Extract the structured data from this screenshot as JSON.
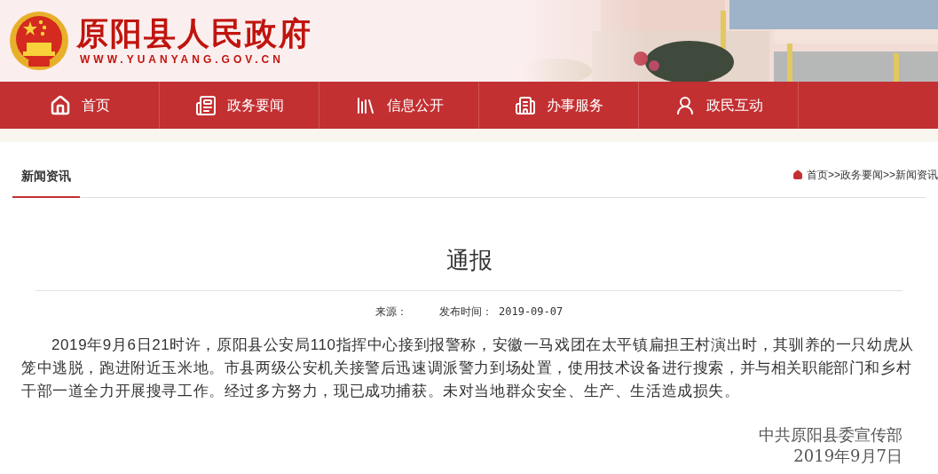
{
  "header": {
    "title": "原阳县人民政府",
    "url": "WWW.YUANYANG.GOV.CN"
  },
  "nav": [
    {
      "label": "首页",
      "kind": "home"
    },
    {
      "label": "政务要闻",
      "kind": "news"
    },
    {
      "label": "信息公开",
      "kind": "books"
    },
    {
      "label": "办事服务",
      "kind": "building"
    },
    {
      "label": "政民互动",
      "kind": "person"
    }
  ],
  "section": {
    "tab": "新闻资讯",
    "breadcrumb": [
      "首页",
      ">>",
      "政务要闻",
      ">>",
      "新闻资讯"
    ]
  },
  "article": {
    "title": "通报",
    "source_label": "来源：",
    "date_label": "发布时间：",
    "date": "2019-09-07",
    "body": "2019年9月6日21时许，原阳县公安局110指挥中心接到报警称，安徽一马戏团在太平镇扁担王村演出时，其驯养的一只幼虎从笼中逃脱，跑进附近玉米地。市县两级公安机关接警后迅速调派警力到场处置，使用技术设备进行搜索，并与相关职能部门和乡村干部一道全力开展搜寻工作。经过多方努力，现已成功捕获。未对当地群众安全、生产、生活造成损失。",
    "signature": [
      "中共原阳县委宣传部",
      "2019年9月7日"
    ]
  }
}
